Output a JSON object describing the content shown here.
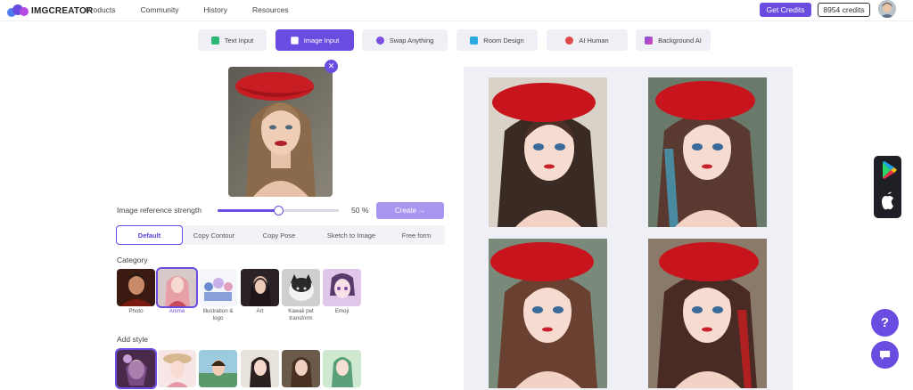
{
  "header": {
    "logo_text": "IMGCREATOR",
    "nav": [
      "Products",
      "Community",
      "History",
      "Resources"
    ],
    "get_credits_label": "Get Credits",
    "credits": "8954 credits"
  },
  "tabs": [
    {
      "label": "Text Input",
      "icon": "text-icon",
      "color": "#2bb673"
    },
    {
      "label": "Image Input",
      "icon": "image-icon",
      "color": "#ffffff"
    },
    {
      "label": "Swap Anything",
      "icon": "swap-icon",
      "color": "#7b4fe0"
    },
    {
      "label": "Room Design",
      "icon": "home-icon",
      "color": "#2aa8e0"
    },
    {
      "label": "AI Human",
      "icon": "human-icon",
      "color": "#e04a4a"
    },
    {
      "label": "Background AI",
      "icon": "background-icon",
      "color": "#7b4fe0"
    }
  ],
  "controls": {
    "strength_label": "Image reference strength",
    "strength_value": 50,
    "strength_text": "50 %",
    "create_label": "Create →"
  },
  "modes": [
    "Default",
    "Copy Contour",
    "Copy Pose",
    "Sketch to Image",
    "Free form"
  ],
  "category": {
    "label": "Category",
    "items": [
      "Photo",
      "Anime",
      "Illustration & logo",
      "Art",
      "Kawaii pet transform",
      "Emoji"
    ]
  },
  "add_style": {
    "label": "Add style"
  },
  "colors": {
    "accent": "#6a4de0",
    "accent_light": "#a996ee",
    "panel_bg": "#eef0f5"
  },
  "floating": {
    "help": "?",
    "store_icons": [
      "google-play-icon",
      "apple-icon"
    ]
  }
}
